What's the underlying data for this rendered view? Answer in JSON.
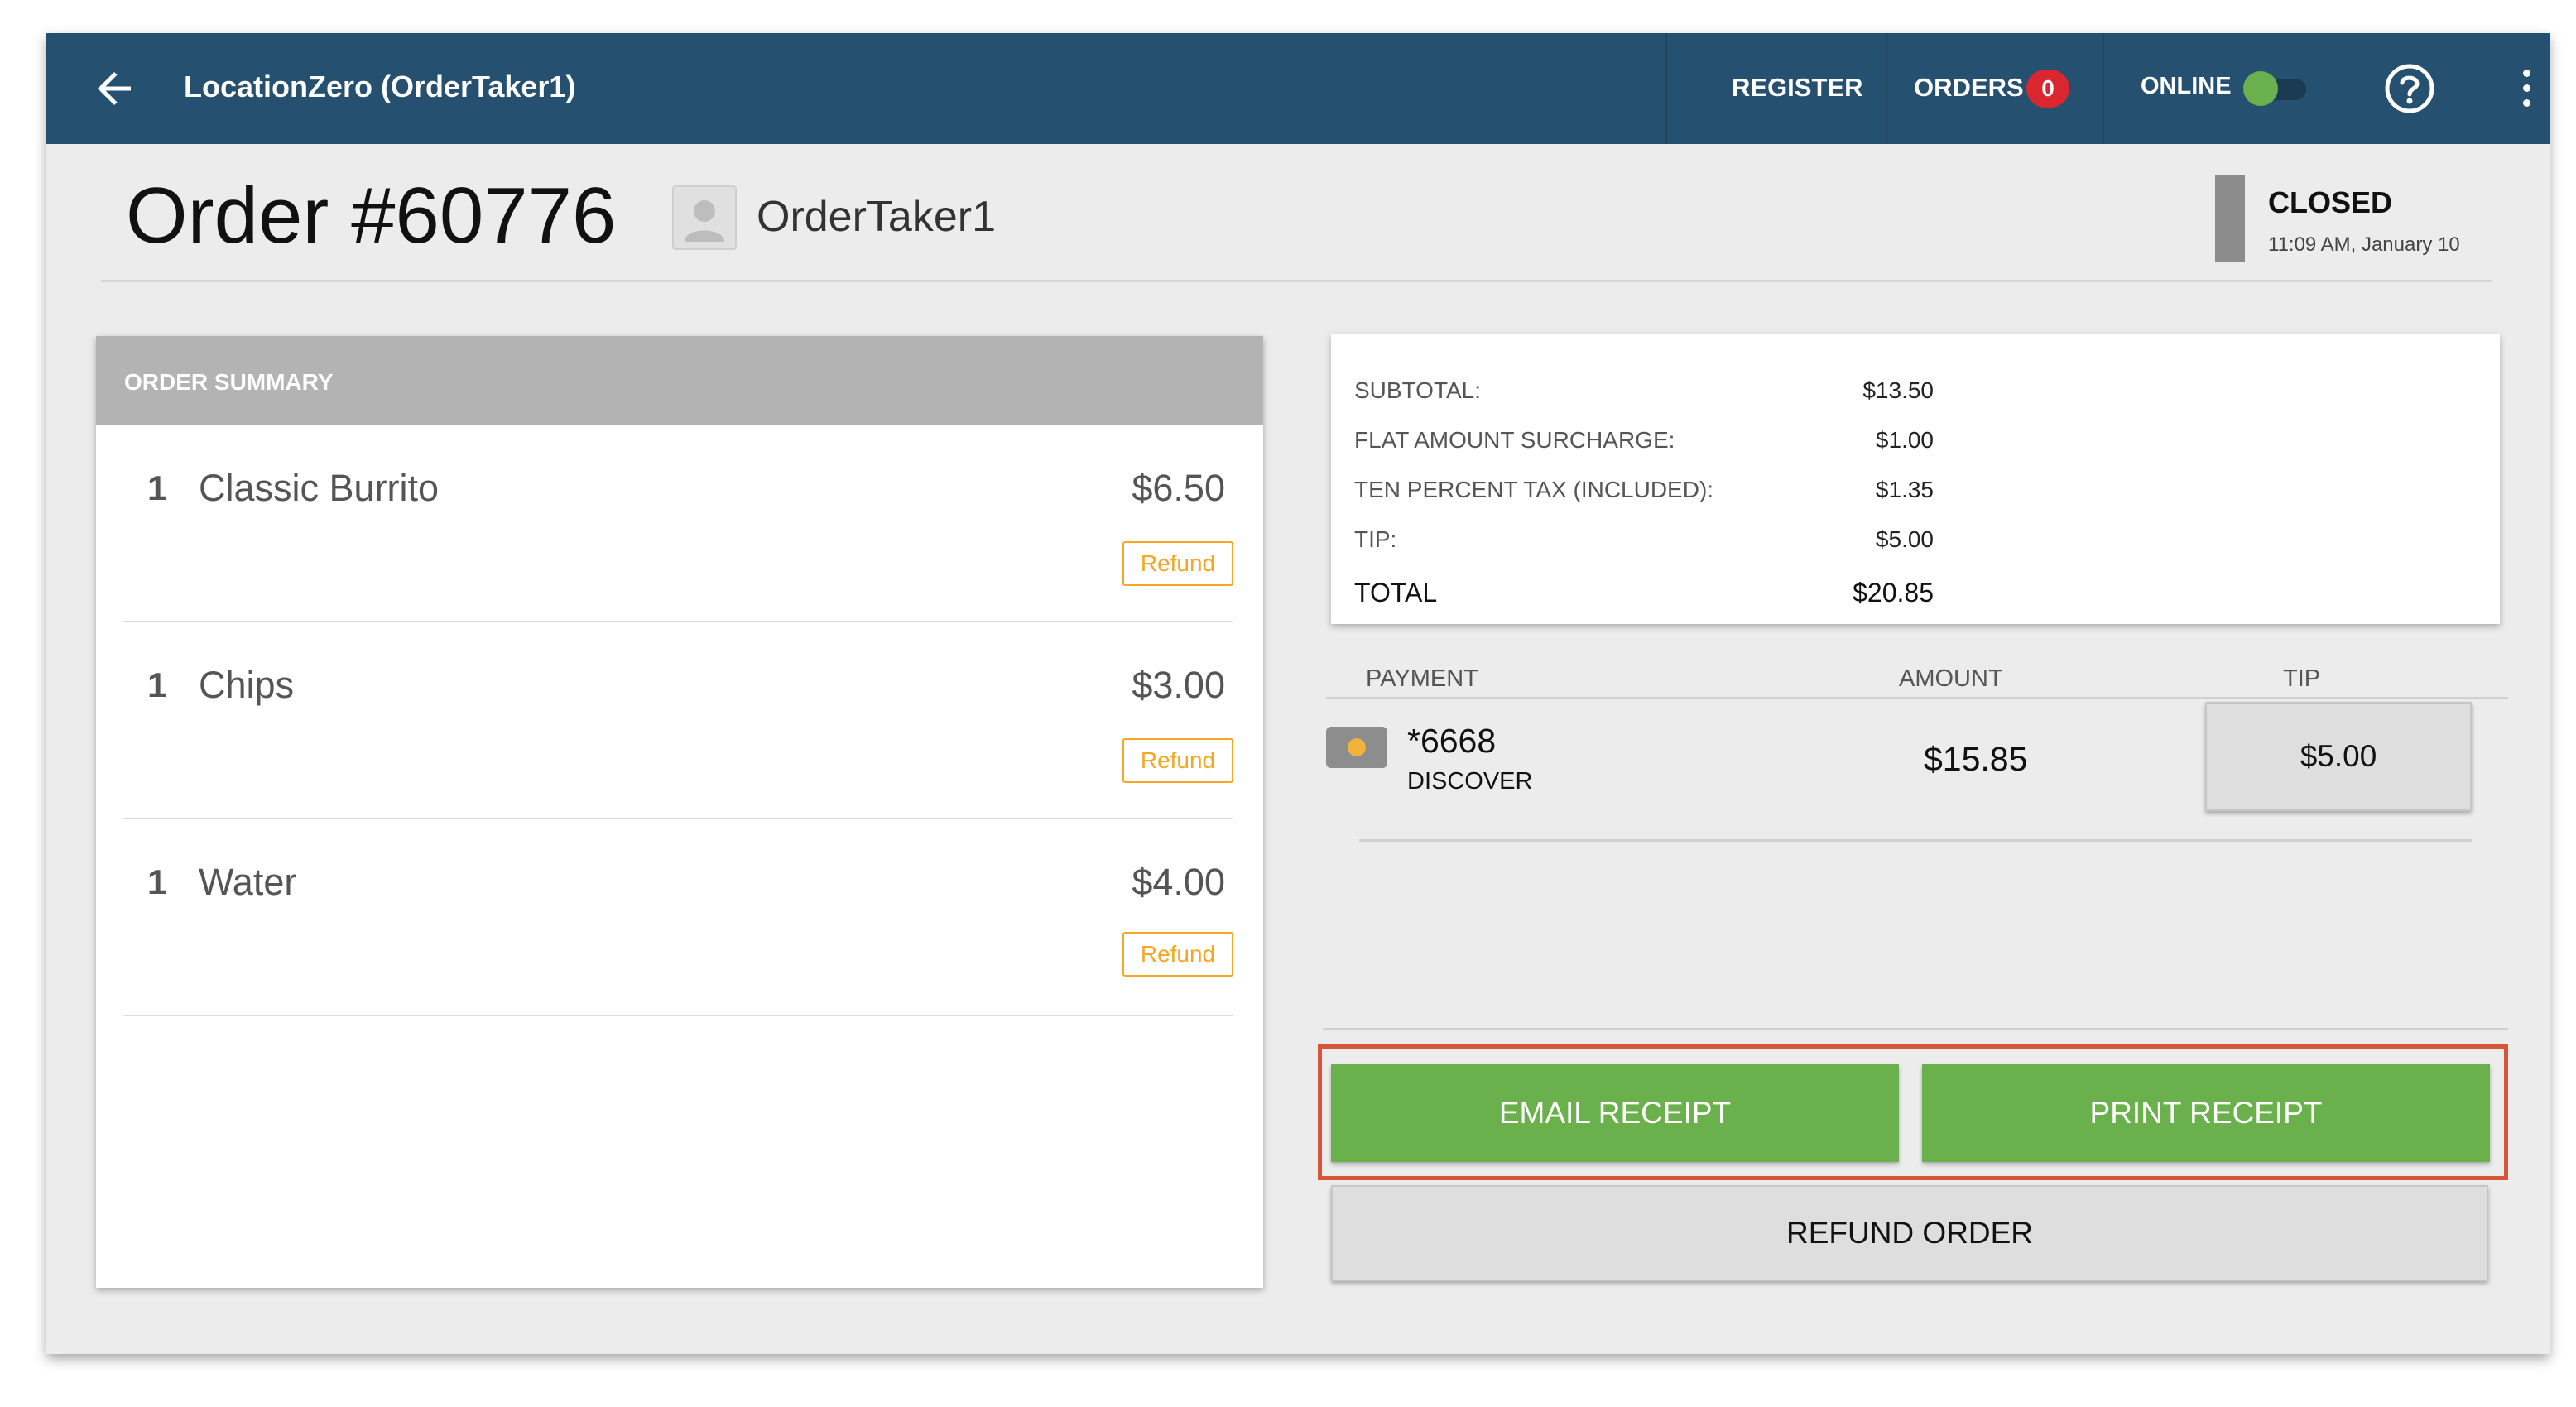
{
  "header": {
    "app_title": "LocationZero (OrderTaker1)",
    "register_label": "REGISTER",
    "orders_label": "ORDERS",
    "orders_count": "0",
    "online_label": "ONLINE",
    "online": true,
    "icons": [
      "arrow-left-icon",
      "help-circle-icon",
      "more-vertical-icon"
    ]
  },
  "order": {
    "title": "Order #60776",
    "taker": "OrderTaker1",
    "status": "CLOSED",
    "time": "11:09 AM, January 10"
  },
  "summary": {
    "header": "ORDER SUMMARY",
    "items": [
      {
        "qty": "1",
        "name": "Classic Burrito",
        "price": "$6.50",
        "refund_label": "Refund"
      },
      {
        "qty": "1",
        "name": "Chips",
        "price": "$3.00",
        "refund_label": "Refund"
      },
      {
        "qty": "1",
        "name": "Water",
        "price": "$4.00",
        "refund_label": "Refund"
      }
    ]
  },
  "totals": {
    "rows": [
      {
        "label": "SUBTOTAL:",
        "value": "$13.50"
      },
      {
        "label": "FLAT AMOUNT SURCHARGE:",
        "value": "$1.00"
      },
      {
        "label": "TEN PERCENT TAX (INCLUDED):",
        "value": "$1.35"
      },
      {
        "label": "TIP:",
        "value": "$5.00"
      }
    ],
    "total_label": "TOTAL",
    "total_value": "$20.85"
  },
  "payment": {
    "col_payment": "PAYMENT",
    "col_amount": "AMOUNT",
    "col_tip": "TIP",
    "card_number": "*6668",
    "card_brand": "DISCOVER",
    "amount": "$15.85",
    "tip": "$5.00"
  },
  "actions": {
    "email_receipt": "EMAIL RECEIPT",
    "print_receipt": "PRINT RECEIPT",
    "refund_order": "REFUND ORDER"
  },
  "colors": {
    "header_bg": "#25506f",
    "accent_green": "#6ab04c",
    "refund_orange": "#f5a623",
    "badge_red": "#d9262f",
    "highlight": "#d9553a"
  }
}
